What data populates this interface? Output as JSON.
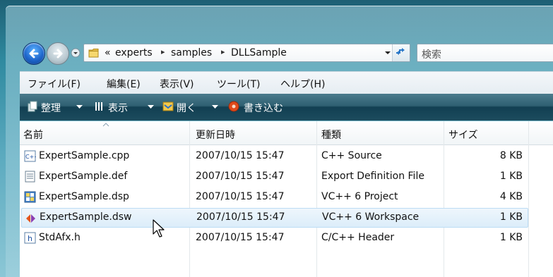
{
  "address": {
    "overflow": "«",
    "crumbs": [
      "experts",
      "samples",
      "DLLSample"
    ],
    "separator": "▸"
  },
  "search": {
    "placeholder": "検索"
  },
  "menu": [
    "ファイル(F)",
    "編集(E)",
    "表示(V)",
    "ツール(T)",
    "ヘルプ(H)"
  ],
  "commands": [
    {
      "label": "整理",
      "icon": "organize-icon"
    },
    {
      "label": "表示",
      "icon": "views-icon"
    },
    {
      "label": "開く",
      "icon": "open-icon"
    },
    {
      "label": "書き込む",
      "icon": "burn-icon"
    }
  ],
  "columns": [
    "名前",
    "更新日時",
    "種類",
    "サイズ"
  ],
  "files": [
    {
      "name": "ExpertSample.cpp",
      "modified": "2007/10/15 15:47",
      "type": "C++ Source",
      "size": "8 KB",
      "icon": "cpp-file-icon",
      "selected": false
    },
    {
      "name": "ExpertSample.def",
      "modified": "2007/10/15 15:47",
      "type": "Export Definition File",
      "size": "1 KB",
      "icon": "def-file-icon",
      "selected": false
    },
    {
      "name": "ExpertSample.dsp",
      "modified": "2007/10/15 15:47",
      "type": "VC++ 6 Project",
      "size": "4 KB",
      "icon": "dsp-file-icon",
      "selected": false
    },
    {
      "name": "ExpertSample.dsw",
      "modified": "2007/10/15 15:47",
      "type": "VC++ 6 Workspace",
      "size": "1 KB",
      "icon": "dsw-file-icon",
      "selected": true
    },
    {
      "name": "StdAfx.h",
      "modified": "2007/10/15 15:47",
      "type": "C/C++ Header",
      "size": "1 KB",
      "icon": "h-file-icon",
      "selected": false
    }
  ]
}
